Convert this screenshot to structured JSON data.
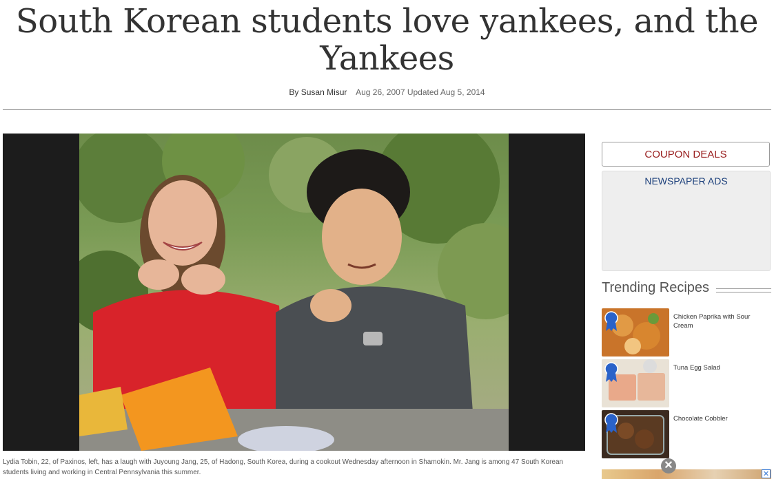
{
  "article": {
    "headline": "South Korean students love yankees, and the Yankees",
    "byline_author": "By Susan Misur",
    "byline_dates": "Aug 26, 2007 Updated Aug 5, 2014",
    "caption": "Lydia Tobin, 22, of Paxinos, left, has a laugh with Juyoung Jang, 25, of Hadong, South Korea, during a cookout Wednesday afternoon in Shamokin. Mr. Jang is among 47 South Korean students living and working in Central Pennsylvania this summer."
  },
  "sidebar": {
    "coupon_label": "COUPON DEALS",
    "ads_label": "NEWSPAPER ADS",
    "trending_title": "Trending Recipes",
    "recipes": [
      {
        "title": "Chicken Paprika with Sour Cream"
      },
      {
        "title": "Tuna Egg Salad"
      },
      {
        "title": "Chocolate Cobbler"
      }
    ]
  },
  "ad": {
    "close_symbol": "✕",
    "x_symbol": "✕"
  },
  "colors": {
    "coupon_text": "#9a2020",
    "ads_text": "#1a3e7a",
    "ribbon_blue": "#2a62c9"
  }
}
